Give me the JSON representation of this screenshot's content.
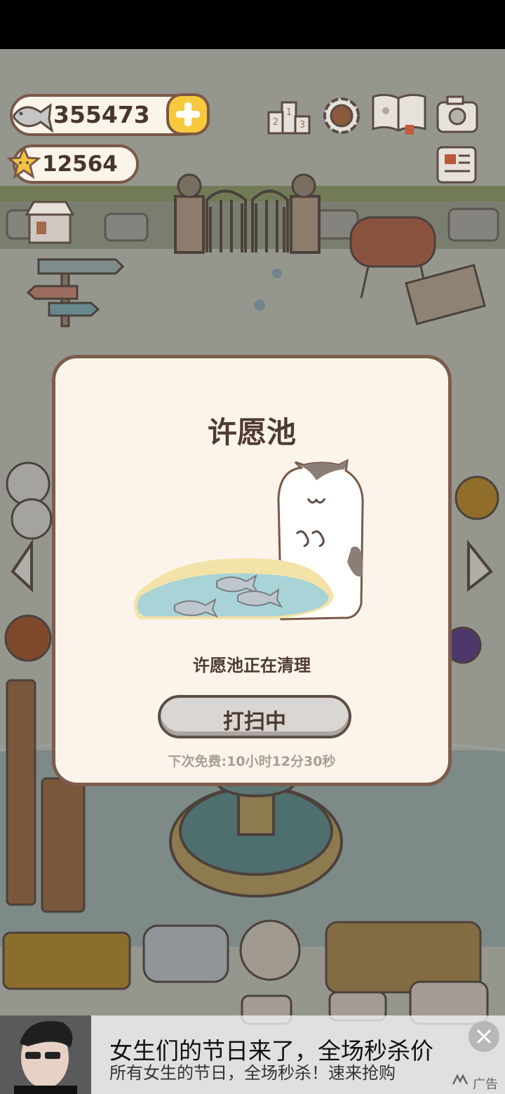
{
  "currency": {
    "fish_count": "355473",
    "star_count": "12564"
  },
  "dialog": {
    "title": "许愿池",
    "message": "许愿池正在清理",
    "button_label": "打扫中",
    "next_free": "下次免费:10小时12分30秒"
  },
  "ad": {
    "title": "女生们的节日来了，全场秒杀价",
    "description": "所有女生的节日，全场秒杀！速来抢购",
    "label": "广告"
  },
  "icons": [
    "fish-icon",
    "star-icon",
    "plus-icon",
    "leaderboard-icon",
    "settings-gear-icon",
    "catbook-icon",
    "camera-icon",
    "newspaper-icon",
    "shop-icon",
    "arrow-left-icon",
    "arrow-right-icon",
    "close-icon"
  ],
  "colors": {
    "panel": "#fcf4eb",
    "border": "#7d5c4e",
    "plus": "#f7c93c"
  }
}
